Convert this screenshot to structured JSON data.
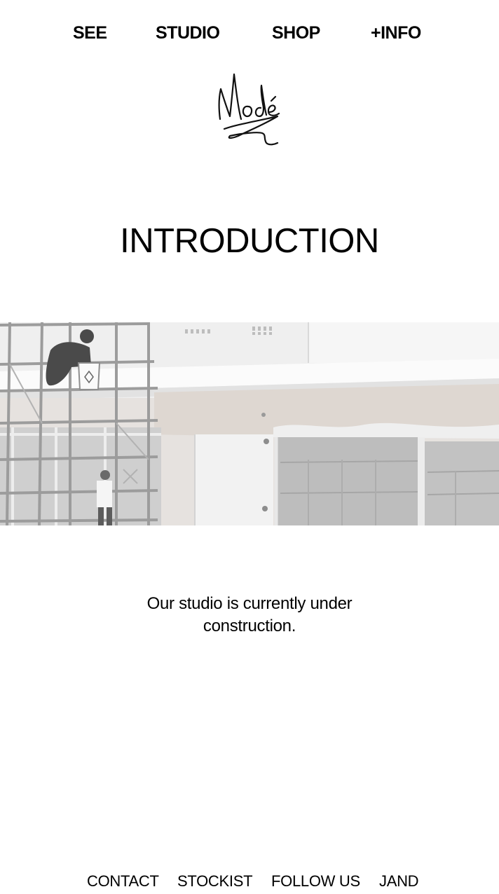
{
  "nav": {
    "items": [
      {
        "label": "SEE"
      },
      {
        "label": "STUDIO"
      },
      {
        "label": "SHOP"
      },
      {
        "label": "+INFO"
      }
    ]
  },
  "logo": {
    "icon": "signature-logo-icon",
    "text": "Modé"
  },
  "intro": {
    "title": "INTRODUCTION"
  },
  "hero": {
    "icon": "construction-photo"
  },
  "status": {
    "text": "Our studio is currently under construction."
  },
  "footer": {
    "items": [
      {
        "label": "CONTACT"
      },
      {
        "label": "STOCKIST"
      },
      {
        "label": "FOLLOW US"
      },
      {
        "label": "JAND"
      }
    ]
  },
  "colors": {
    "text": "#000000",
    "background": "#ffffff",
    "photo_wall": "#ededed",
    "photo_glass": "#b9b9b9"
  }
}
